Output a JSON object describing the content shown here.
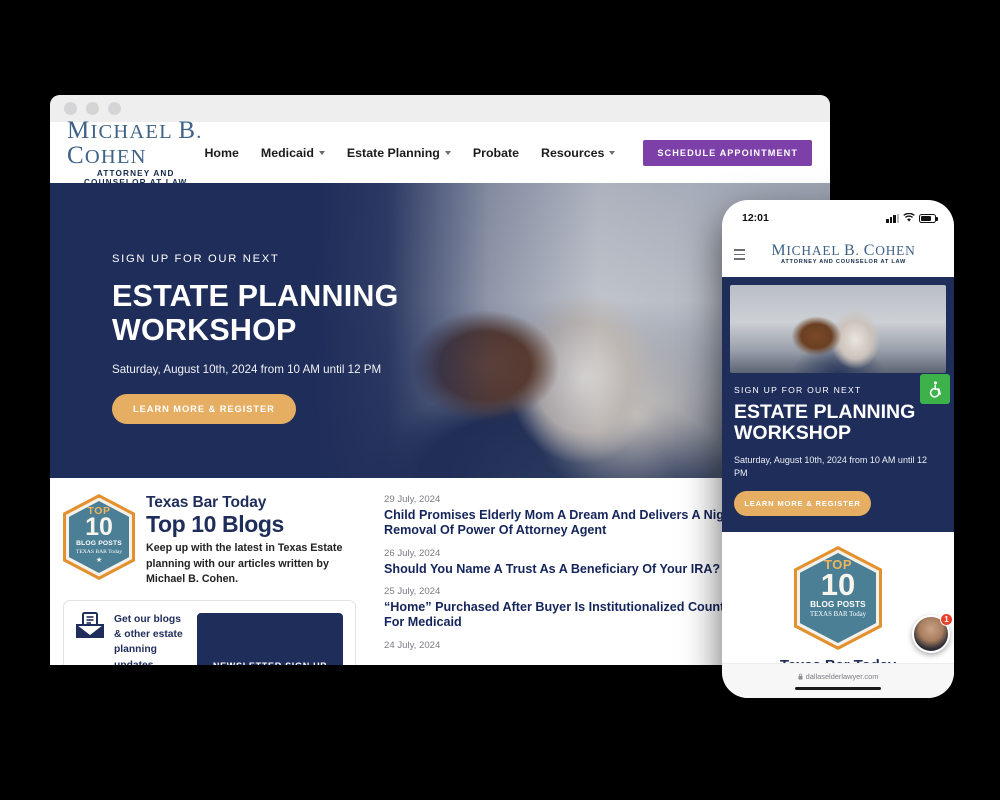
{
  "desktop": {
    "chrome": {
      "dots": [
        "close",
        "minimize",
        "maximize"
      ]
    },
    "logo": {
      "name": "MICHAEL B. COHEN",
      "tagline": "ATTORNEY AND COUNSELOR AT LAW"
    },
    "nav": [
      {
        "label": "Home",
        "has_dropdown": false
      },
      {
        "label": "Medicaid",
        "has_dropdown": true
      },
      {
        "label": "Estate Planning",
        "has_dropdown": true
      },
      {
        "label": "Probate",
        "has_dropdown": false
      },
      {
        "label": "Resources",
        "has_dropdown": true
      }
    ],
    "cta": {
      "label": "SCHEDULE APPOINTMENT",
      "color": "#7d3fa8"
    },
    "hero": {
      "eyebrow": "SIGN UP FOR OUR NEXT",
      "title_line1": "ESTATE PLANNING",
      "title_line2": "WORKSHOP",
      "subtitle": "Saturday, August 10th, 2024 from 10 AM until 12 PM",
      "button": "LEARN MORE & REGISTER",
      "bg_color": "#1f2d5a",
      "button_color": "#e5ae63"
    },
    "badge": {
      "top": "TOP",
      "number": "10",
      "posts": "BLOG POSTS",
      "source": "TEXAS BAR Today",
      "star": "★"
    },
    "blurb": {
      "kicker": "Texas Bar Today",
      "headline": "Top 10 Blogs",
      "body": "Keep up with the latest in Texas Estate planning with our articles written by Michael B. Cohen."
    },
    "newsletter": {
      "text": "Get our blogs & other estate planning updates directly in your email inbox!",
      "button": "NEWSLETTER SIGN UP"
    },
    "posts": [
      {
        "date": "29 July, 2024",
        "title": "Child Promises Elderly Mom A Dream And Delivers A Nightmare – Removal Of Power Of Attorney Agent"
      },
      {
        "date": "26 July, 2024",
        "title": "Should You Name A Trust As A Beneficiary Of Your IRA?"
      },
      {
        "date": "25 July, 2024",
        "title": "“Home” Purchased After Buyer Is Institutionalized Counts As Exempt For Medicaid"
      },
      {
        "date": "24 July, 2024",
        "title": ""
      }
    ]
  },
  "phone": {
    "status": {
      "time": "12:01",
      "signal": "signal-bars",
      "wifi": "wifi-icon",
      "battery": "battery-icon"
    },
    "logo": {
      "name": "MICHAEL B. COHEN",
      "tagline": "ATTORNEY AND COUNSELOR AT LAW"
    },
    "hero": {
      "eyebrow": "SIGN UP FOR OUR NEXT",
      "title_line1": "ESTATE PLANNING",
      "title_line2": "WORKSHOP",
      "subtitle": "Saturday, August 10th, 2024 from 10 AM until 12 PM",
      "button": "LEARN MORE & REGISTER"
    },
    "badge": {
      "top": "TOP",
      "number": "10",
      "posts": "BLOG POSTS",
      "source": "TEXAS BAR Today"
    },
    "tbt_title": "Texas Bar Today",
    "url": "dallaselderlawyer.com"
  },
  "widgets": {
    "accessibility": {
      "icon": "wheelchair-icon",
      "color": "#3db24a"
    },
    "chat": {
      "icon": "avatar",
      "badge_count": "1",
      "badge_color": "#e8402a"
    }
  }
}
